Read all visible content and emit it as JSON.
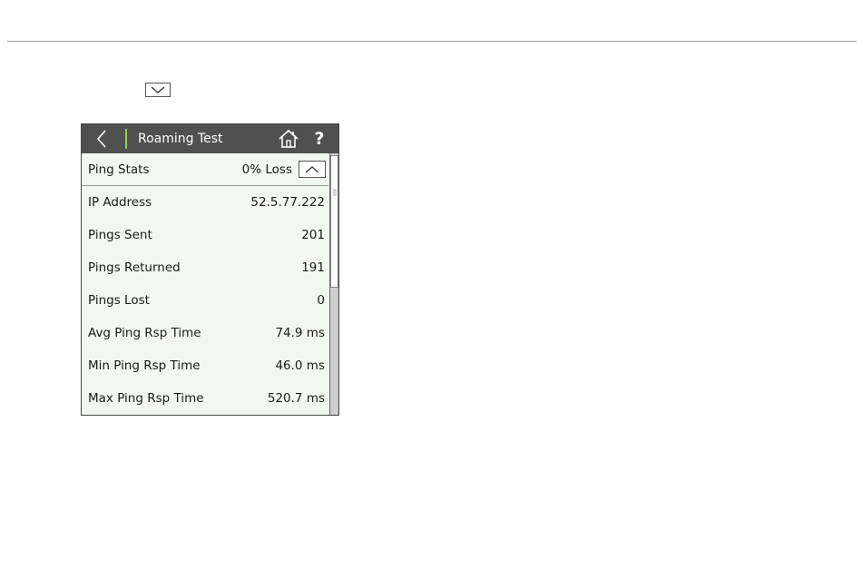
{
  "app": {
    "title": "Roaming Test"
  },
  "icons": {
    "collapse": "chevron-down-icon",
    "back": "chevron-left-icon",
    "home": "home-icon",
    "help": "help-icon",
    "expand": "chevron-up-icon"
  },
  "header": {
    "help_label": "?"
  },
  "colors": {
    "titlebar_bg": "#505050",
    "accent": "#9bd14a",
    "content_bg": "#f3f7f1"
  },
  "ping_stats": {
    "label": "Ping Stats",
    "summary": "0% Loss"
  },
  "rows": [
    {
      "label": "IP Address",
      "value": "52.5.77.222"
    },
    {
      "label": "Pings Sent",
      "value": "201"
    },
    {
      "label": "Pings Returned",
      "value": "191"
    },
    {
      "label": "Pings Lost",
      "value": "0"
    },
    {
      "label": "Avg Ping Rsp Time",
      "value": "74.9 ms"
    },
    {
      "label": "Min Ping Rsp Time",
      "value": "46.0 ms"
    },
    {
      "label": "Max Ping Rsp Time",
      "value": "520.7 ms"
    }
  ]
}
